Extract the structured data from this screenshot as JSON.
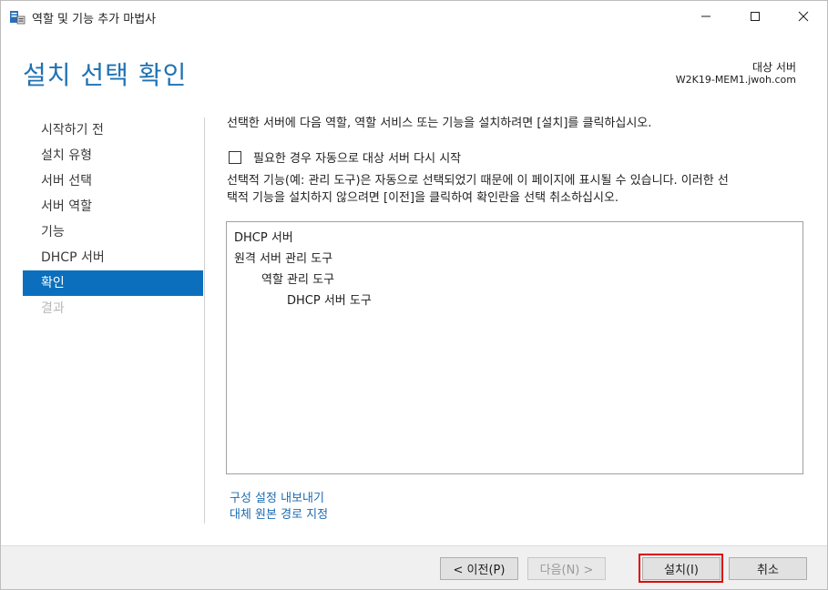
{
  "window": {
    "title": "역할 및 기능 추가 마법사",
    "controls": {
      "minimize": "minimize-icon",
      "maximize": "maximize-icon",
      "close": "close-icon"
    }
  },
  "header": {
    "page_title": "설치 선택 확인",
    "target_label": "대상 서버",
    "target_name": "W2K19-MEM1.jwoh.com"
  },
  "nav": {
    "items": [
      {
        "label": "시작하기 전",
        "state": "normal"
      },
      {
        "label": "설치 유형",
        "state": "normal"
      },
      {
        "label": "서버 선택",
        "state": "normal"
      },
      {
        "label": "서버 역할",
        "state": "normal"
      },
      {
        "label": "기능",
        "state": "normal"
      },
      {
        "label": "DHCP 서버",
        "state": "normal"
      },
      {
        "label": "확인",
        "state": "active"
      },
      {
        "label": "결과",
        "state": "disabled"
      }
    ]
  },
  "content": {
    "intro": "선택한 서버에 다음 역할, 역할 서비스 또는 기능을 설치하려면 [설치]를 클릭하십시오.",
    "restart_checkbox": {
      "label": "필요한 경우 자동으로 대상 서버 다시 시작",
      "checked": false
    },
    "optional_note_line1": "선택적 기능(예: 관리 도구)은 자동으로 선택되었기 때문에 이 페이지에 표시될 수 있습니다. 이러한 선",
    "optional_note_line2": "택적 기능을 설치하지 않으려면 [이전]을 클릭하여 확인란을 선택 취소하십시오.",
    "features": [
      {
        "text": "DHCP 서버",
        "level": 0
      },
      {
        "text": "원격 서버 관리 도구",
        "level": 0
      },
      {
        "text": "역할 관리 도구",
        "level": 1
      },
      {
        "text": "DHCP 서버 도구",
        "level": 2
      }
    ],
    "links": {
      "export": "구성 설정 내보내기",
      "alternate_source": "대체 원본 경로 지정"
    }
  },
  "footer": {
    "prev": "< 이전(P)",
    "next": "다음(N) >",
    "install": "설치(I)",
    "cancel": "취소"
  },
  "colors": {
    "title_blue": "#1f72b3",
    "nav_active_bg": "#0b6fbd",
    "link_blue": "#1d6bb0",
    "highlight_red": "#e00000"
  }
}
